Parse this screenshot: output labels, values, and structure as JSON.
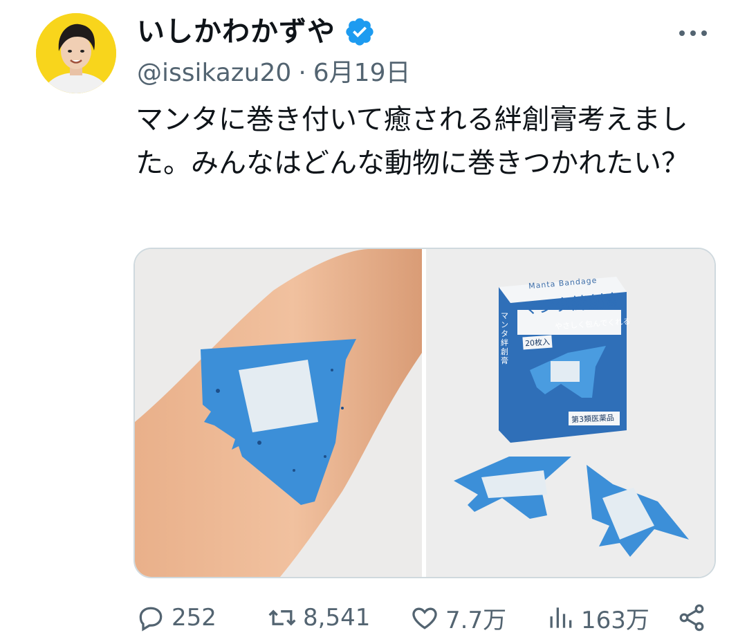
{
  "user": {
    "display_name": "いしかわかずや",
    "handle": "@issikazu20",
    "separator": "·",
    "date": "6月19日",
    "verified": true
  },
  "tweet": {
    "text": "マンタに巻き付いて癒される絆創膏考えました。みんなはどんな動物に巻きつかれたい？"
  },
  "media": {
    "box": {
      "brand": "Manta Bandage",
      "title": "マンタ絆創膏",
      "subtitle": "やさしく包んでくれる",
      "count": "20枚入",
      "side_title": "マンタ絆創膏",
      "category": "第3類医薬品"
    }
  },
  "stats": {
    "replies": "252",
    "reposts": "8,541",
    "likes": "7.7万",
    "views": "163万"
  },
  "colors": {
    "accent": "#1d9bf0",
    "text": "#0f1419",
    "secondary": "#536471",
    "avatar_bg": "#f8d51c",
    "bandage_blue": "#3c8fd8"
  }
}
